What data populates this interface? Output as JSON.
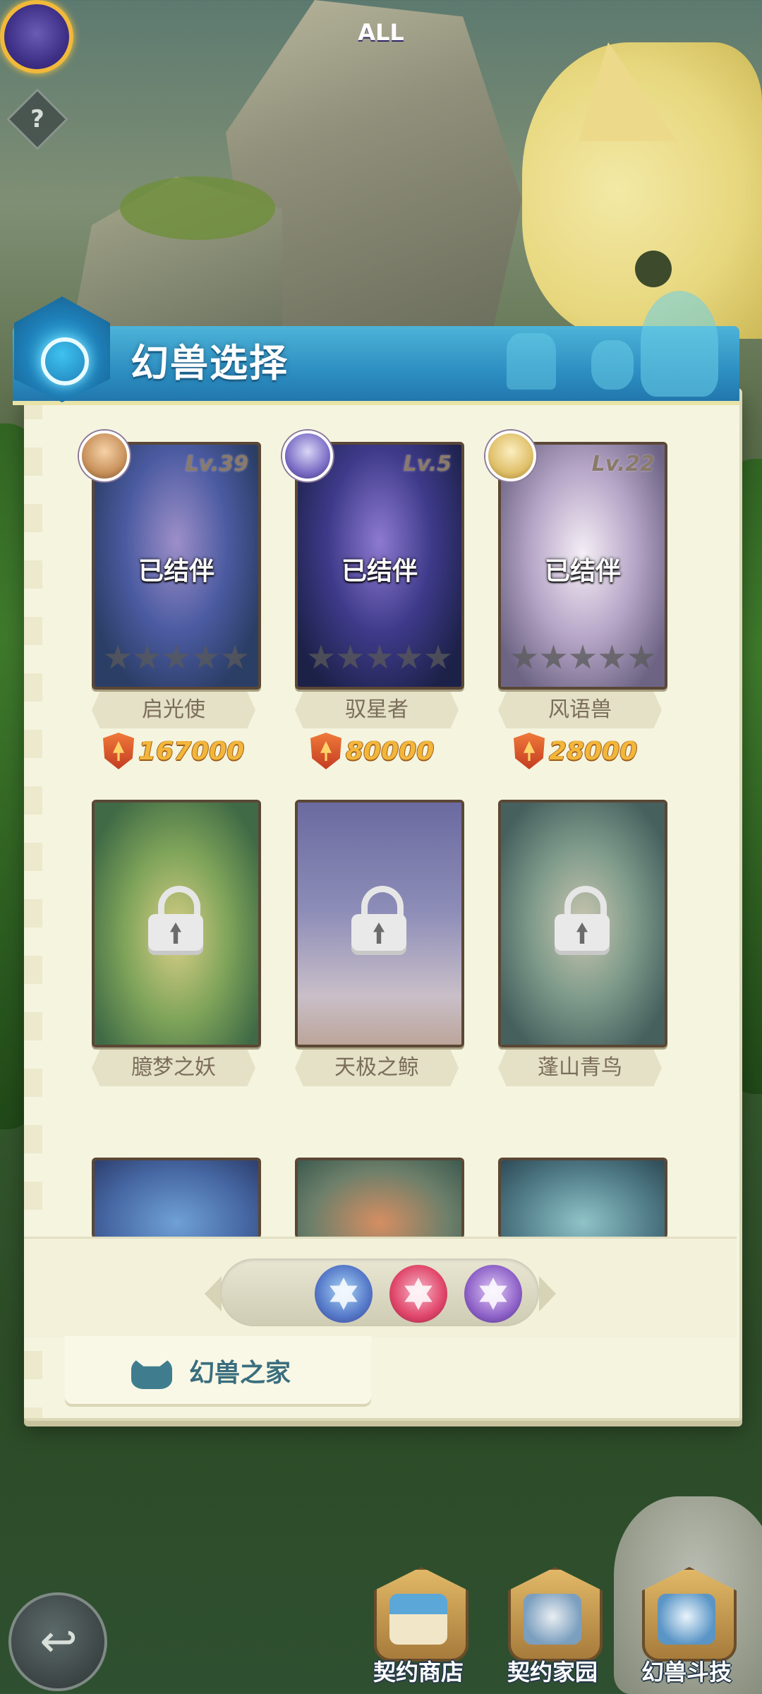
{
  "title": "幻兽选择",
  "help_icon": "?",
  "partnered_cards": [
    {
      "name": "启光使",
      "level": "Lv.39",
      "status": "已结伴",
      "power": "167000"
    },
    {
      "name": "驭星者",
      "level": "Lv.5",
      "status": "已结伴",
      "power": "80000"
    },
    {
      "name": "风语兽",
      "level": "Lv.22",
      "status": "已结伴",
      "power": "28000"
    }
  ],
  "locked_cards": [
    {
      "name": "臆梦之妖"
    },
    {
      "name": "天极之鲸"
    },
    {
      "name": "蓬山青鸟"
    }
  ],
  "filter": {
    "all_label": "ALL"
  },
  "home_tab": {
    "label": "幻兽之家"
  },
  "bottom_nav": [
    {
      "label": "契约商店"
    },
    {
      "label": "契约家园"
    },
    {
      "label": "幻兽斗技"
    }
  ],
  "colors": {
    "title_bar": "#2d8fc2",
    "panel_bg": "#f5f4df",
    "power_text": "#f3b63a",
    "name_tag_bg": "#e4e1c6"
  }
}
